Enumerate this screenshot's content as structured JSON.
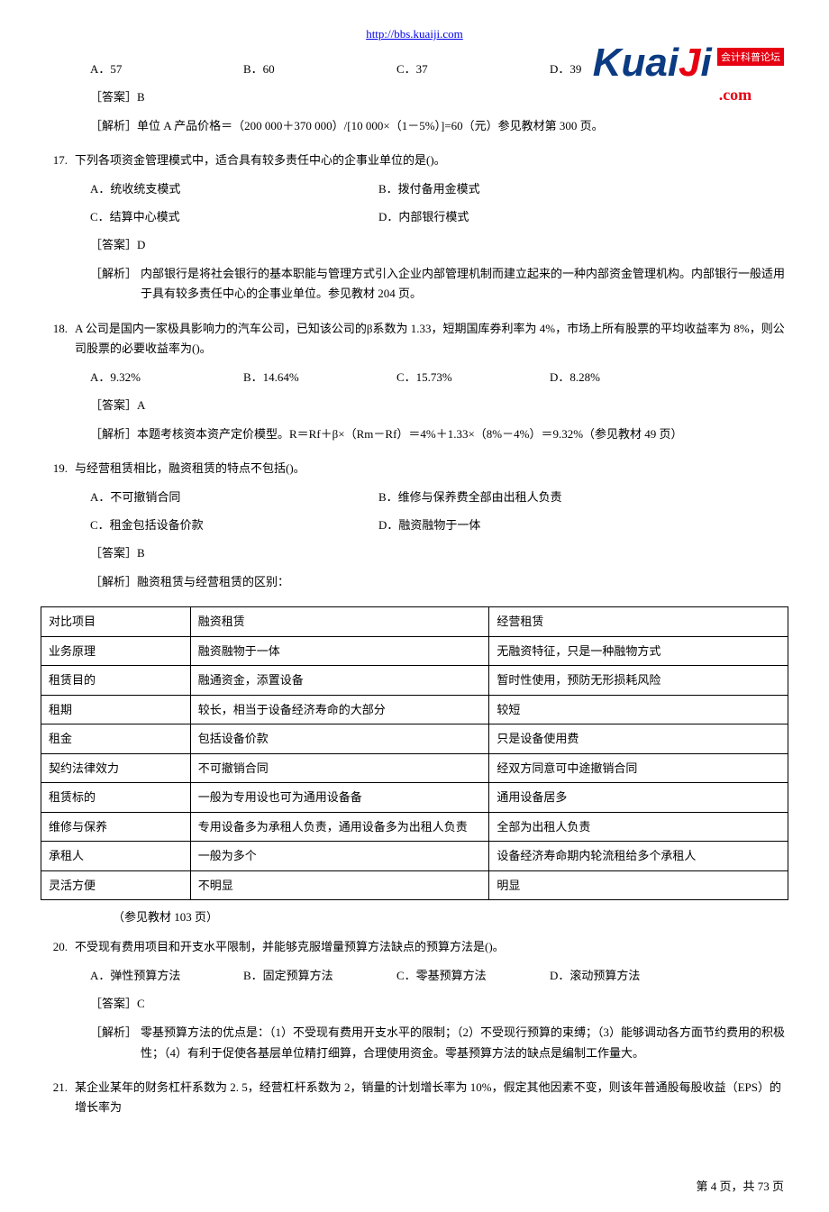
{
  "header": {
    "url": "http://bbs.kuaiji.com"
  },
  "logo": {
    "brand": "Kuaiji",
    "suffix": ".com",
    "badge": "会计科普论坛"
  },
  "q16": {
    "optA": "A．57",
    "optB": "B．60",
    "optC": "C．37",
    "optD": "D．39",
    "answer": "［答案］B",
    "analysis": "［解析］单位 A 产品价格＝（200 000＋370 000）/[10 000×（1－5%）]=60（元）参见教材第 300 页。"
  },
  "q17": {
    "num": "17.",
    "text": "下列各项资金管理模式中，适合具有较多责任中心的企事业单位的是()。",
    "optA": "A．统收统支模式",
    "optB": "B．拨付备用金模式",
    "optC": "C．结算中心模式",
    "optD": "D．内部银行模式",
    "answer": "［答案］D",
    "analysisLabel": "［解析］",
    "analysis": "内部银行是将社会银行的基本职能与管理方式引入企业内部管理机制而建立起来的一种内部资金管理机构。内部银行一般适用于具有较多责任中心的企事业单位。参见教材 204 页。"
  },
  "q18": {
    "num": "18.",
    "text": "A 公司是国内一家极具影响力的汽车公司，已知该公司的β系数为 1.33，短期国库券利率为 4%，市场上所有股票的平均收益率为 8%，则公司股票的必要收益率为()。",
    "optA": "A．9.32%",
    "optB": "B．14.64%",
    "optC": "C．15.73%",
    "optD": "D．8.28%",
    "answer": "［答案］A",
    "analysis": "［解析］本题考核资本资产定价模型。R＝Rf＋β×（Rm－Rf）＝4%＋1.33×（8%－4%）＝9.32%（参见教材 49 页）"
  },
  "q19": {
    "num": "19.",
    "text": "与经营租赁相比，融资租赁的特点不包括()。",
    "optA": "A．不可撤销合同",
    "optB": "B．维修与保养费全部由出租人负责",
    "optC": "C．租金包括设备价款",
    "optD": "D．融资融物于一体",
    "answer": "［答案］B",
    "analysisIntro": "［解析］融资租赁与经营租赁的区别：",
    "tableNote": "（参见教材 103 页）"
  },
  "table19": {
    "header": {
      "c1": "对比项目",
      "c2": "融资租赁",
      "c3": "经营租赁"
    },
    "rows": [
      {
        "c1": "业务原理",
        "c2": "融资融物于一体",
        "c3": "无融资特征，只是一种融物方式"
      },
      {
        "c1": "租赁目的",
        "c2": "融通资金，添置设备",
        "c3": "暂时性使用，预防无形损耗风险"
      },
      {
        "c1": "租期",
        "c2": "较长，相当于设备经济寿命的大部分",
        "c3": "较短"
      },
      {
        "c1": "租金",
        "c2": "包括设备价款",
        "c3": "只是设备使用费"
      },
      {
        "c1": "契约法律效力",
        "c2": "不可撤销合同",
        "c3": "经双方同意可中途撤销合同"
      },
      {
        "c1": "租赁标的",
        "c2": "一般为专用设也可为通用设备备",
        "c3": "通用设备居多"
      },
      {
        "c1": "维修与保养",
        "c2": "专用设备多为承租人负责，通用设备多为出租人负责",
        "c3": "全部为出租人负责"
      },
      {
        "c1": "承租人",
        "c2": "一般为多个",
        "c3": "设备经济寿命期内轮流租给多个承租人"
      },
      {
        "c1": "灵活方便",
        "c2": "不明显",
        "c3": "明显"
      }
    ]
  },
  "q20": {
    "num": "20.",
    "text": "不受现有费用项目和开支水平限制，并能够克服增量预算方法缺点的预算方法是()。",
    "optA": "A．弹性预算方法",
    "optB": "B．固定预算方法",
    "optC": "C．零基预算方法",
    "optD": "D．滚动预算方法",
    "answer": "［答案］C",
    "analysisLabel": "［解析］",
    "analysis": "零基预算方法的优点是：（1）不受现有费用开支水平的限制；（2）不受现行预算的束缚；（3）能够调动各方面节约费用的积极性；（4）有利于促使各基层单位精打细算，合理使用资金。零基预算方法的缺点是编制工作量大。"
  },
  "q21": {
    "num": "21.",
    "text": "某企业某年的财务杠杆系数为 2. 5，经营杠杆系数为 2，销量的计划增长率为 10%，假定其他因素不变，则该年普通股每股收益（EPS）的增长率为"
  },
  "footer": {
    "text": "第 4 页，共 73 页"
  }
}
